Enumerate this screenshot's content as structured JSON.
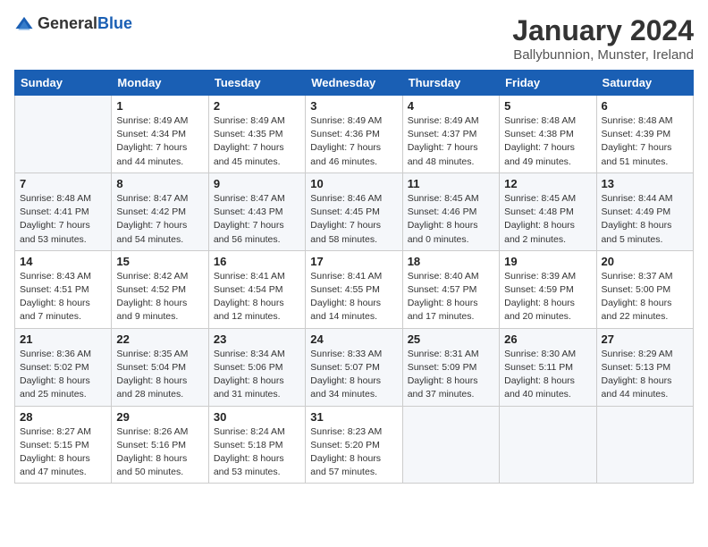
{
  "logo": {
    "general": "General",
    "blue": "Blue"
  },
  "title": "January 2024",
  "location": "Ballybunnion, Munster, Ireland",
  "days_header": [
    "Sunday",
    "Monday",
    "Tuesday",
    "Wednesday",
    "Thursday",
    "Friday",
    "Saturday"
  ],
  "weeks": [
    [
      {
        "day": "",
        "sunrise": "",
        "sunset": "",
        "daylight": ""
      },
      {
        "day": "1",
        "sunrise": "Sunrise: 8:49 AM",
        "sunset": "Sunset: 4:34 PM",
        "daylight": "Daylight: 7 hours and 44 minutes."
      },
      {
        "day": "2",
        "sunrise": "Sunrise: 8:49 AM",
        "sunset": "Sunset: 4:35 PM",
        "daylight": "Daylight: 7 hours and 45 minutes."
      },
      {
        "day": "3",
        "sunrise": "Sunrise: 8:49 AM",
        "sunset": "Sunset: 4:36 PM",
        "daylight": "Daylight: 7 hours and 46 minutes."
      },
      {
        "day": "4",
        "sunrise": "Sunrise: 8:49 AM",
        "sunset": "Sunset: 4:37 PM",
        "daylight": "Daylight: 7 hours and 48 minutes."
      },
      {
        "day": "5",
        "sunrise": "Sunrise: 8:48 AM",
        "sunset": "Sunset: 4:38 PM",
        "daylight": "Daylight: 7 hours and 49 minutes."
      },
      {
        "day": "6",
        "sunrise": "Sunrise: 8:48 AM",
        "sunset": "Sunset: 4:39 PM",
        "daylight": "Daylight: 7 hours and 51 minutes."
      }
    ],
    [
      {
        "day": "7",
        "sunrise": "Sunrise: 8:48 AM",
        "sunset": "Sunset: 4:41 PM",
        "daylight": "Daylight: 7 hours and 53 minutes."
      },
      {
        "day": "8",
        "sunrise": "Sunrise: 8:47 AM",
        "sunset": "Sunset: 4:42 PM",
        "daylight": "Daylight: 7 hours and 54 minutes."
      },
      {
        "day": "9",
        "sunrise": "Sunrise: 8:47 AM",
        "sunset": "Sunset: 4:43 PM",
        "daylight": "Daylight: 7 hours and 56 minutes."
      },
      {
        "day": "10",
        "sunrise": "Sunrise: 8:46 AM",
        "sunset": "Sunset: 4:45 PM",
        "daylight": "Daylight: 7 hours and 58 minutes."
      },
      {
        "day": "11",
        "sunrise": "Sunrise: 8:45 AM",
        "sunset": "Sunset: 4:46 PM",
        "daylight": "Daylight: 8 hours and 0 minutes."
      },
      {
        "day": "12",
        "sunrise": "Sunrise: 8:45 AM",
        "sunset": "Sunset: 4:48 PM",
        "daylight": "Daylight: 8 hours and 2 minutes."
      },
      {
        "day": "13",
        "sunrise": "Sunrise: 8:44 AM",
        "sunset": "Sunset: 4:49 PM",
        "daylight": "Daylight: 8 hours and 5 minutes."
      }
    ],
    [
      {
        "day": "14",
        "sunrise": "Sunrise: 8:43 AM",
        "sunset": "Sunset: 4:51 PM",
        "daylight": "Daylight: 8 hours and 7 minutes."
      },
      {
        "day": "15",
        "sunrise": "Sunrise: 8:42 AM",
        "sunset": "Sunset: 4:52 PM",
        "daylight": "Daylight: 8 hours and 9 minutes."
      },
      {
        "day": "16",
        "sunrise": "Sunrise: 8:41 AM",
        "sunset": "Sunset: 4:54 PM",
        "daylight": "Daylight: 8 hours and 12 minutes."
      },
      {
        "day": "17",
        "sunrise": "Sunrise: 8:41 AM",
        "sunset": "Sunset: 4:55 PM",
        "daylight": "Daylight: 8 hours and 14 minutes."
      },
      {
        "day": "18",
        "sunrise": "Sunrise: 8:40 AM",
        "sunset": "Sunset: 4:57 PM",
        "daylight": "Daylight: 8 hours and 17 minutes."
      },
      {
        "day": "19",
        "sunrise": "Sunrise: 8:39 AM",
        "sunset": "Sunset: 4:59 PM",
        "daylight": "Daylight: 8 hours and 20 minutes."
      },
      {
        "day": "20",
        "sunrise": "Sunrise: 8:37 AM",
        "sunset": "Sunset: 5:00 PM",
        "daylight": "Daylight: 8 hours and 22 minutes."
      }
    ],
    [
      {
        "day": "21",
        "sunrise": "Sunrise: 8:36 AM",
        "sunset": "Sunset: 5:02 PM",
        "daylight": "Daylight: 8 hours and 25 minutes."
      },
      {
        "day": "22",
        "sunrise": "Sunrise: 8:35 AM",
        "sunset": "Sunset: 5:04 PM",
        "daylight": "Daylight: 8 hours and 28 minutes."
      },
      {
        "day": "23",
        "sunrise": "Sunrise: 8:34 AM",
        "sunset": "Sunset: 5:06 PM",
        "daylight": "Daylight: 8 hours and 31 minutes."
      },
      {
        "day": "24",
        "sunrise": "Sunrise: 8:33 AM",
        "sunset": "Sunset: 5:07 PM",
        "daylight": "Daylight: 8 hours and 34 minutes."
      },
      {
        "day": "25",
        "sunrise": "Sunrise: 8:31 AM",
        "sunset": "Sunset: 5:09 PM",
        "daylight": "Daylight: 8 hours and 37 minutes."
      },
      {
        "day": "26",
        "sunrise": "Sunrise: 8:30 AM",
        "sunset": "Sunset: 5:11 PM",
        "daylight": "Daylight: 8 hours and 40 minutes."
      },
      {
        "day": "27",
        "sunrise": "Sunrise: 8:29 AM",
        "sunset": "Sunset: 5:13 PM",
        "daylight": "Daylight: 8 hours and 44 minutes."
      }
    ],
    [
      {
        "day": "28",
        "sunrise": "Sunrise: 8:27 AM",
        "sunset": "Sunset: 5:15 PM",
        "daylight": "Daylight: 8 hours and 47 minutes."
      },
      {
        "day": "29",
        "sunrise": "Sunrise: 8:26 AM",
        "sunset": "Sunset: 5:16 PM",
        "daylight": "Daylight: 8 hours and 50 minutes."
      },
      {
        "day": "30",
        "sunrise": "Sunrise: 8:24 AM",
        "sunset": "Sunset: 5:18 PM",
        "daylight": "Daylight: 8 hours and 53 minutes."
      },
      {
        "day": "31",
        "sunrise": "Sunrise: 8:23 AM",
        "sunset": "Sunset: 5:20 PM",
        "daylight": "Daylight: 8 hours and 57 minutes."
      },
      {
        "day": "",
        "sunrise": "",
        "sunset": "",
        "daylight": ""
      },
      {
        "day": "",
        "sunrise": "",
        "sunset": "",
        "daylight": ""
      },
      {
        "day": "",
        "sunrise": "",
        "sunset": "",
        "daylight": ""
      }
    ]
  ]
}
